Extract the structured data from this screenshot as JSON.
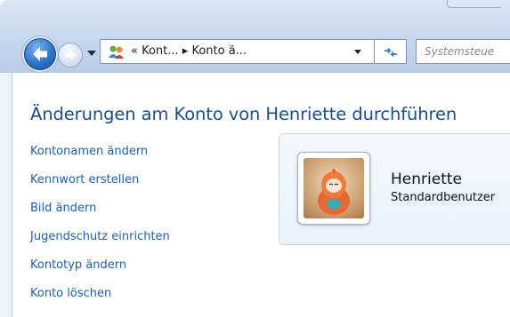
{
  "navigation": {
    "back_icon": "back-arrow-icon",
    "forward_icon": "forward-arrow-icon"
  },
  "address_bar": {
    "icon": "control-panel-users-icon",
    "text": "« Kont... ▸ Konto ä..."
  },
  "search": {
    "placeholder": "Systemsteue"
  },
  "page": {
    "title": "Änderungen am Konto von Henriette durchführen"
  },
  "tasks": [
    {
      "label": "Kontonamen ändern"
    },
    {
      "label": "Kennwort erstellen"
    },
    {
      "label": "Bild ändern"
    },
    {
      "label": "Jugendschutz einrichten"
    },
    {
      "label": "Kontotyp ändern"
    },
    {
      "label": "Konto löschen"
    }
  ],
  "account": {
    "name": "Henriette",
    "type": "Standardbenutzer"
  },
  "colors": {
    "heading": "#1e4c8c",
    "link": "#1a5fae",
    "chrome": "#c6d7ee",
    "panel": "#e9f2fb"
  }
}
